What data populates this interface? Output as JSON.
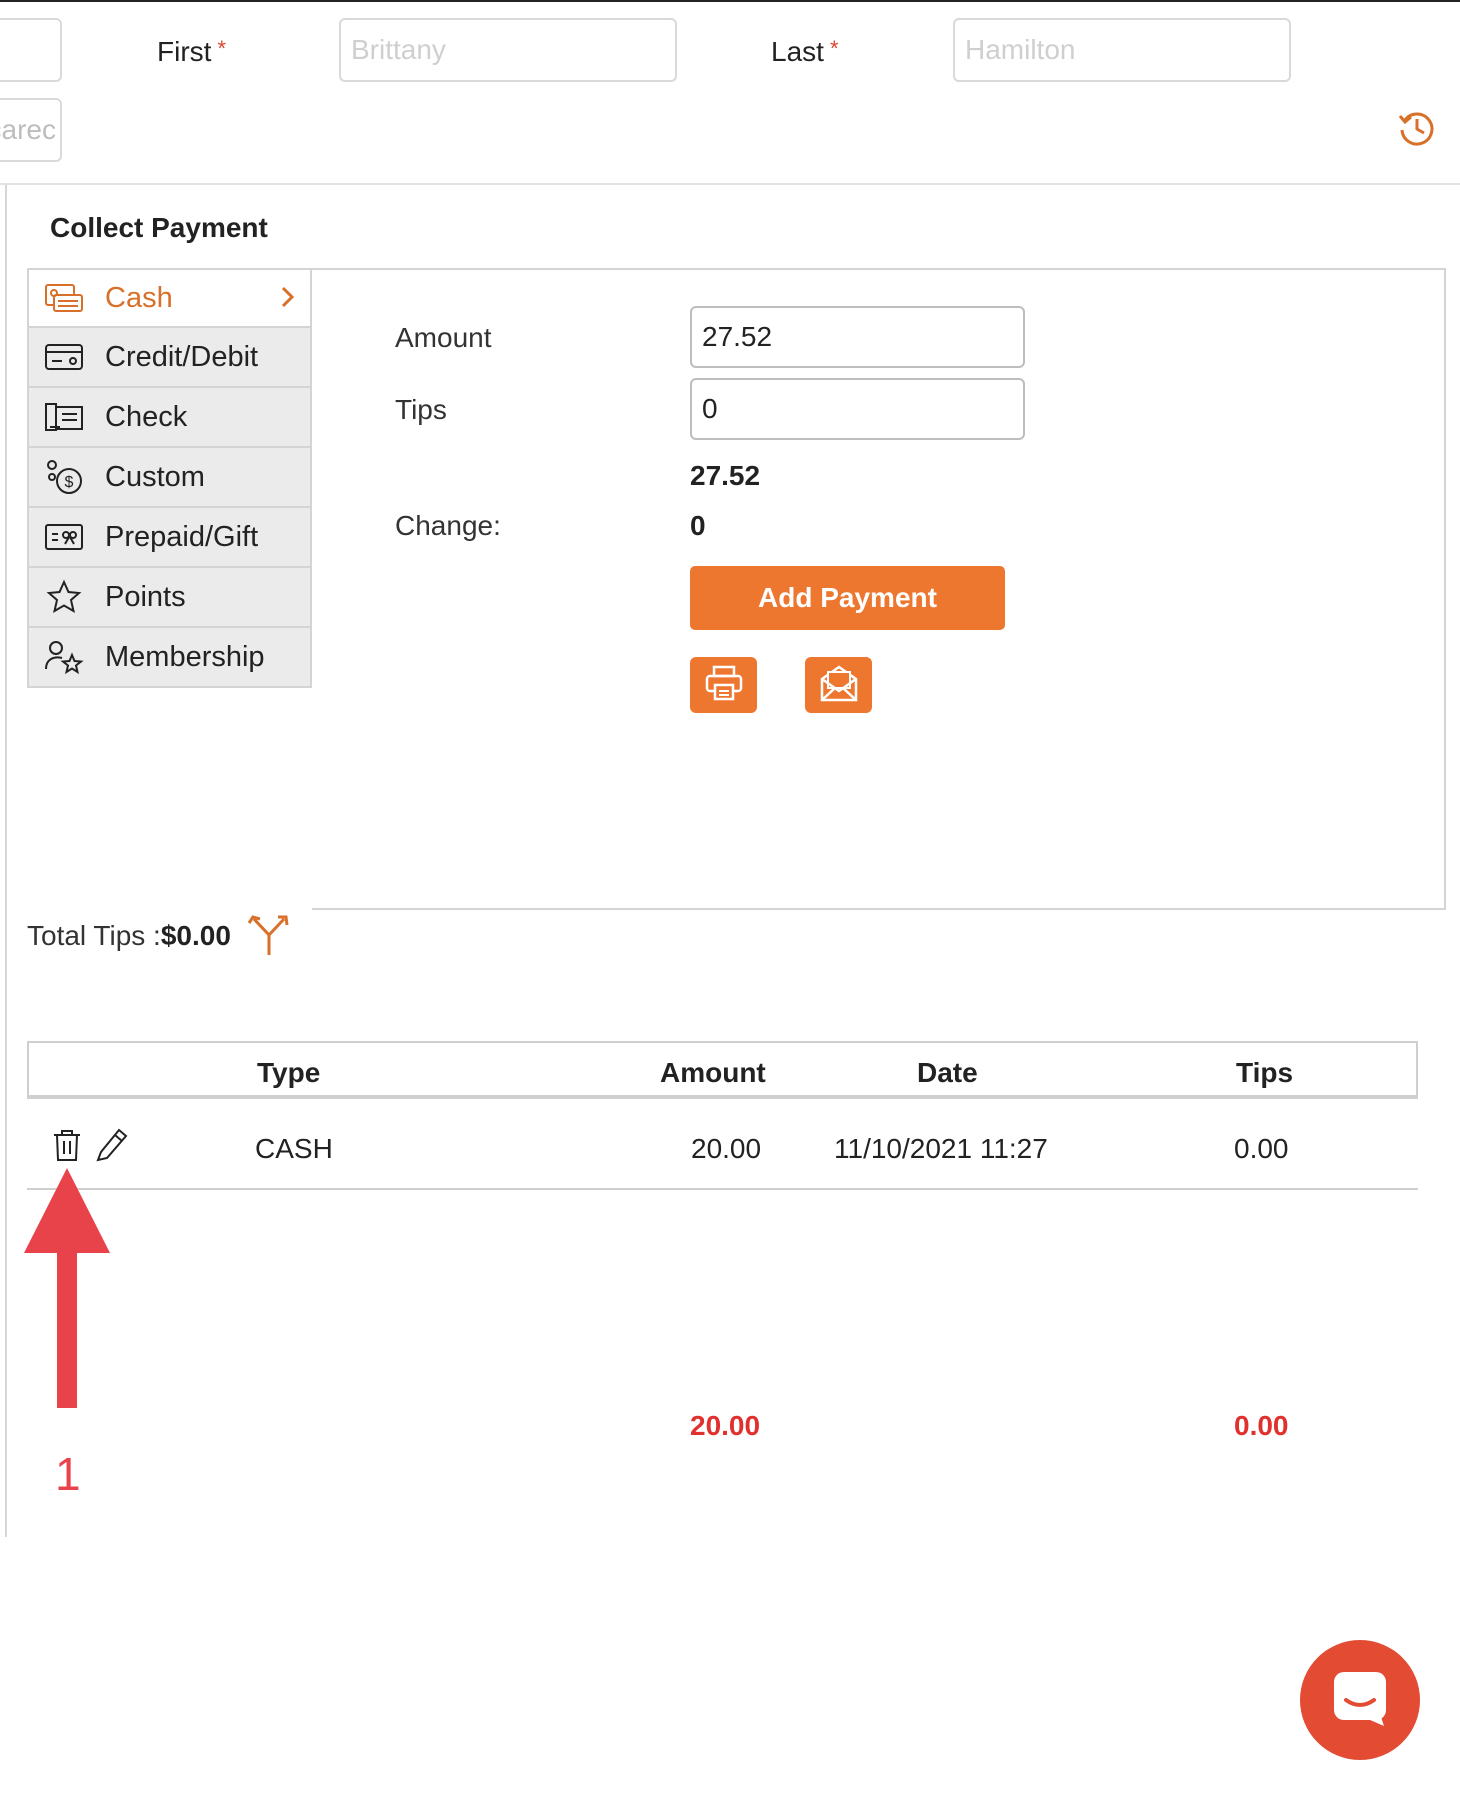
{
  "header": {
    "partial_field_value": "carec",
    "first_label": "First",
    "first_placeholder": "Brittany",
    "last_label": "Last",
    "last_placeholder": "Hamilton",
    "required_mark": "*"
  },
  "collect": {
    "title": "Collect Payment",
    "methods": [
      {
        "label": "Cash",
        "icon": "cash-icon"
      },
      {
        "label": "Credit/Debit",
        "icon": "card-icon"
      },
      {
        "label": "Check",
        "icon": "check-icon"
      },
      {
        "label": "Custom",
        "icon": "custom-icon"
      },
      {
        "label": "Prepaid/Gift",
        "icon": "gift-card-icon"
      },
      {
        "label": "Points",
        "icon": "star-icon"
      },
      {
        "label": "Membership",
        "icon": "membership-icon"
      }
    ]
  },
  "panel": {
    "amount_label": "Amount",
    "amount_value": "27.52",
    "tips_label": "Tips",
    "tips_value": "0",
    "subtotal": "27.52",
    "change_label": "Change:",
    "change_value": "0",
    "add_payment_label": "Add Payment"
  },
  "tips_summary": {
    "label": "Total Tips :",
    "value": "$0.00"
  },
  "table": {
    "headers": {
      "type": "Type",
      "amount": "Amount",
      "date": "Date",
      "tips": "Tips"
    },
    "rows": [
      {
        "type": "CASH",
        "amount": "20.00",
        "date": "11/10/2021 11:27",
        "tips": "0.00"
      }
    ],
    "totals": {
      "amount": "20.00",
      "tips": "0.00"
    }
  },
  "annotation": {
    "number": "1"
  },
  "colors": {
    "accent": "#ee7730",
    "total_red": "#e0312e",
    "arrow": "#e8424a",
    "chat": "#e34b33"
  }
}
